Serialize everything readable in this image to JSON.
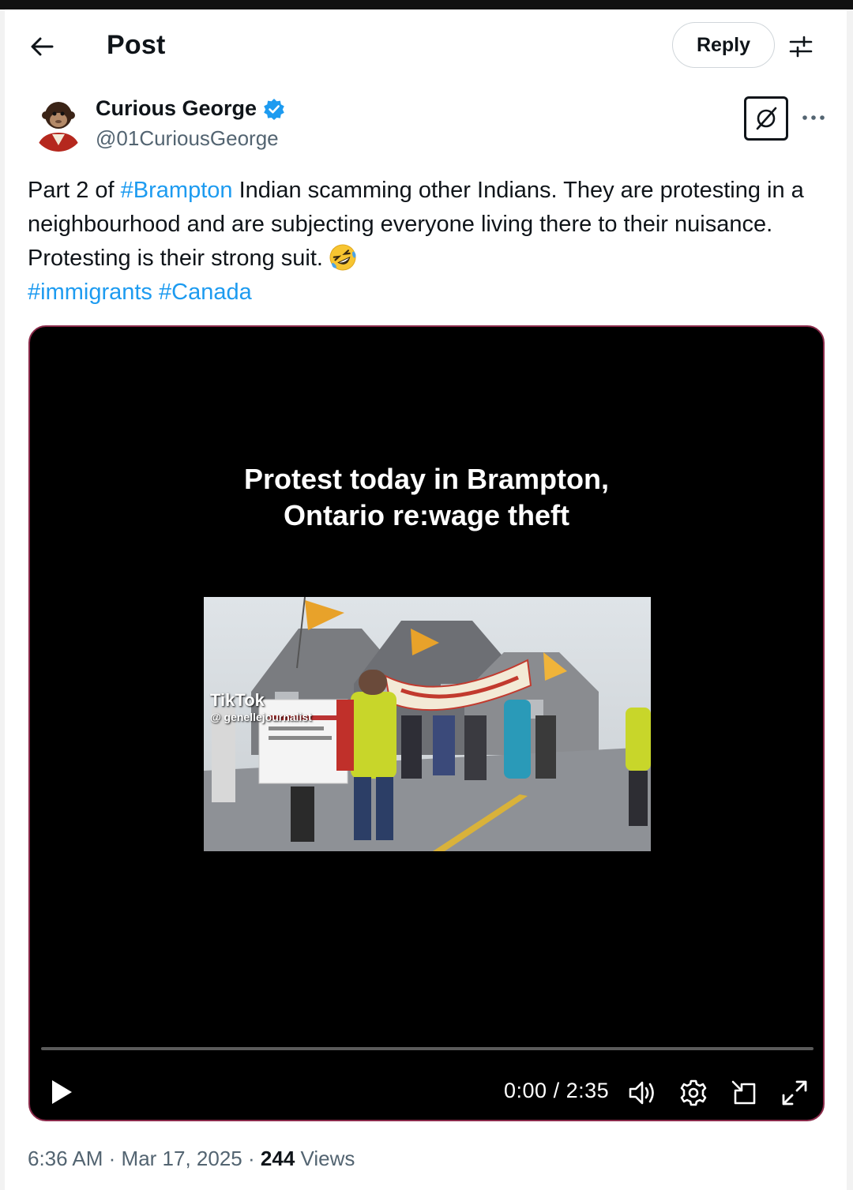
{
  "header": {
    "title": "Post",
    "reply_label": "Reply",
    "back_icon": "arrow-left-icon",
    "filter_icon": "sliders-icon"
  },
  "author": {
    "display_name": "Curious George",
    "handle": "@01CuriousGeorge",
    "verified": true,
    "verified_color": "#1d9bf0"
  },
  "tweet": {
    "text_part1": "Part 2 of ",
    "hashtag1": "#Brampton",
    "text_part2": " Indian scamming other Indians.  They are protesting in a neighbourhood and are subjecting everyone living there to their nuisance.  Protesting is their strong suit.",
    "emoji": "rolling-on-floor-laughing",
    "hashtag2": "#immigrants",
    "hashtag3": "#Canada",
    "link_color": "#1d9bf0"
  },
  "video": {
    "caption_line1": "Protest today in Brampton,",
    "caption_line2": "Ontario re:wage theft",
    "watermark_logo": "TikTok",
    "watermark_handle": "@ genellejournalist",
    "time_current": "0:00",
    "time_total": "2:35",
    "progress": 0
  },
  "meta": {
    "time": "6:36 AM",
    "date": "Mar 17, 2025",
    "views_count": "244",
    "views_label": "Views",
    "sep": "·"
  }
}
